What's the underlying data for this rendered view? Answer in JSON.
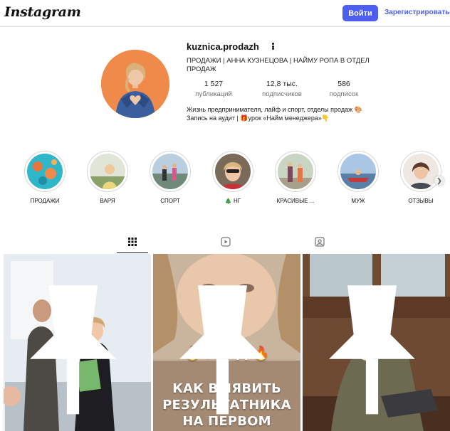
{
  "header": {
    "logo": "Instagram",
    "login_label": "Войти",
    "signup_label": "Зарегистрироваться"
  },
  "profile": {
    "username": "kuznica.prodazh",
    "title": "ПРОДАЖИ | АННА КУЗНЕЦОВА | НАЙМУ РОПА В ОТДЕЛ ПРОДАЖ",
    "stats": [
      {
        "value": "1 527",
        "label": "публикаций"
      },
      {
        "value": "12,8 тыс.",
        "label": "подписчиков"
      },
      {
        "value": "586",
        "label": "подписок"
      }
    ],
    "bio_line1": "Жизнь предпринимателя, лайф и спорт, отделы продаж 🎨",
    "bio_line2": "Запись на аудит | 🎁урок «Найм менеджера»👇"
  },
  "highlights": [
    {
      "label": "ПРОДАЖИ"
    },
    {
      "label": "ВАРЯ"
    },
    {
      "label": "СПОРТ"
    },
    {
      "label": "🎄 НГ"
    },
    {
      "label": "КРАСИВЫЕ ..."
    },
    {
      "label": "МУЖ"
    },
    {
      "label": "ОТЗЫВЫ"
    }
  ],
  "tabs": [
    {
      "icon": "grid-icon"
    },
    {
      "icon": "reels-icon"
    },
    {
      "icon": "tagged-icon"
    }
  ],
  "posts": [
    {
      "pinned": true
    },
    {
      "pinned": true,
      "text_line1": "🔥 ГАЙД 🔥",
      "text_line2": "КАК ВЫЯВИТЬ",
      "text_line3": "РЕЗУЛЬТАТНИКА",
      "text_line4": "НА ПЕРВОМ"
    },
    {
      "pinned": true
    }
  ],
  "colors": {
    "accent": "#4c5ff0",
    "avatar_bg": "#ef8a4a",
    "border": "#e3e3e3"
  }
}
